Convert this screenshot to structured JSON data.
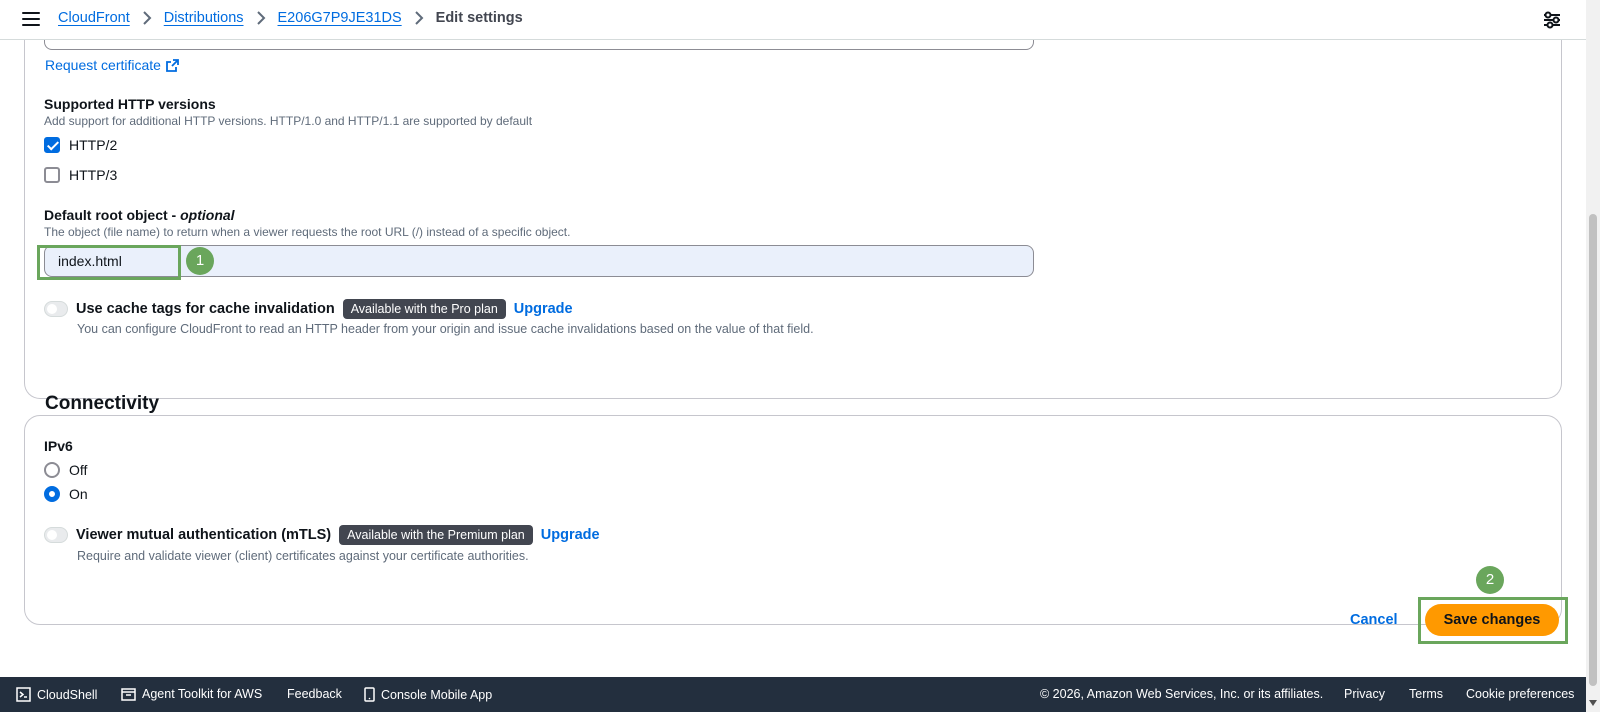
{
  "breadcrumb": {
    "items": [
      "CloudFront",
      "Distributions",
      "E206G7P9JE31DS"
    ],
    "current": "Edit settings"
  },
  "settings": {
    "request_certificate": "Request certificate",
    "http_versions": {
      "label": "Supported HTTP versions",
      "description": "Add support for additional HTTP versions. HTTP/1.0 and HTTP/1.1 are supported by default",
      "options": [
        {
          "label": "HTTP/2",
          "checked": true
        },
        {
          "label": "HTTP/3",
          "checked": false
        }
      ]
    },
    "default_root": {
      "label": "Default root object",
      "optional": "optional",
      "separator": " - ",
      "description": "The object (file name) to return when a viewer requests the root URL (/) instead of a specific object.",
      "value": "index.html"
    },
    "cache_tags": {
      "label": "Use cache tags for cache invalidation",
      "badge": "Available with the Pro plan",
      "upgrade": "Upgrade",
      "description": "You can configure CloudFront to read an HTTP header from your origin and issue cache invalidations based on the value of that field."
    }
  },
  "connectivity": {
    "title": "Connectivity",
    "ipv6": {
      "label": "IPv6",
      "options": [
        {
          "label": "Off",
          "selected": false
        },
        {
          "label": "On",
          "selected": true
        }
      ]
    },
    "mtls": {
      "label": "Viewer mutual authentication (mTLS)",
      "badge": "Available with the Premium plan",
      "upgrade": "Upgrade",
      "description": "Require and validate viewer (client) certificates against your certificate authorities."
    }
  },
  "actions": {
    "cancel": "Cancel",
    "save": "Save changes"
  },
  "markers": {
    "one": "1",
    "two": "2"
  },
  "footer": {
    "cloudshell": "CloudShell",
    "agent_toolkit": "Agent Toolkit for AWS",
    "feedback": "Feedback",
    "mobile_app": "Console Mobile App",
    "copyright": "© 2026, Amazon Web Services, Inc. or its affiliates.",
    "privacy": "Privacy",
    "terms": "Terms",
    "cookies": "Cookie preferences"
  },
  "colors": {
    "link": "#006ce0",
    "primary_button": "#ff9900",
    "footer_bg": "#232f3e",
    "annotation": "#6aa65c",
    "badge_bg": "#424650"
  }
}
